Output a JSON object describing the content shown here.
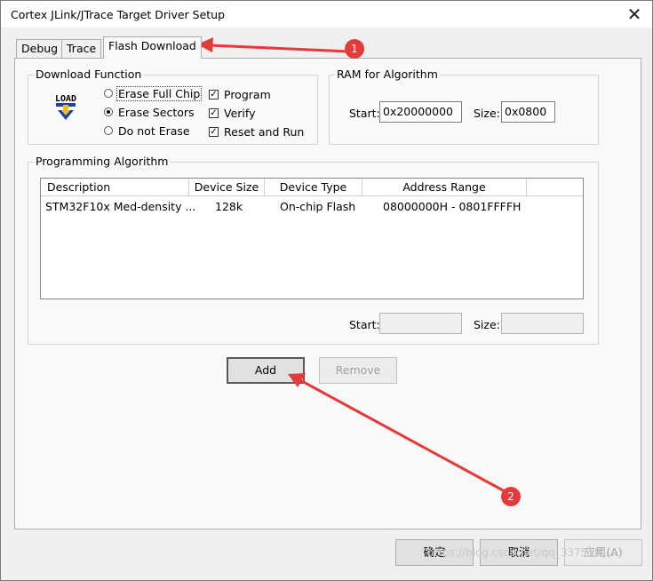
{
  "window": {
    "title": "Cortex JLink/JTrace Target Driver Setup",
    "close": "✕"
  },
  "tabs": [
    {
      "label": "Debug"
    },
    {
      "label": "Trace"
    },
    {
      "label": "Flash Download"
    }
  ],
  "download_function": {
    "legend": "Download Function",
    "load_icon_text": "LOAD",
    "radios": [
      {
        "label": "Erase Full Chip",
        "selected": false
      },
      {
        "label": "Erase Sectors",
        "selected": true
      },
      {
        "label": "Do not Erase",
        "selected": false
      }
    ],
    "checks": [
      {
        "label": "Program",
        "checked": true,
        "mark": "✓"
      },
      {
        "label": "Verify",
        "checked": true,
        "mark": "✓"
      },
      {
        "label": "Reset and Run",
        "checked": true,
        "mark": "✓"
      }
    ]
  },
  "ram": {
    "legend": "RAM for Algorithm",
    "start_label": "Start:",
    "start_value": "0x20000000",
    "size_label": "Size:",
    "size_value": "0x0800"
  },
  "programming": {
    "legend": "Programming Algorithm",
    "columns": [
      "Description",
      "Device Size",
      "Device Type",
      "Address Range"
    ],
    "rows": [
      {
        "description": "STM32F10x Med-density ...",
        "size": "128k",
        "type": "On-chip Flash",
        "range": "08000000H - 0801FFFFH"
      }
    ],
    "start_label": "Start:",
    "start_value": "",
    "size_label": "Size:",
    "size_value": ""
  },
  "buttons": {
    "add": "Add",
    "remove": "Remove"
  },
  "footer": {
    "ok": "确定",
    "cancel": "取消",
    "apply": "应用(A)"
  },
  "annotations": {
    "one": "1",
    "two": "2",
    "color": "#e53a3a"
  },
  "watermark": "https://blog.csdn.net/qq_3375181..."
}
